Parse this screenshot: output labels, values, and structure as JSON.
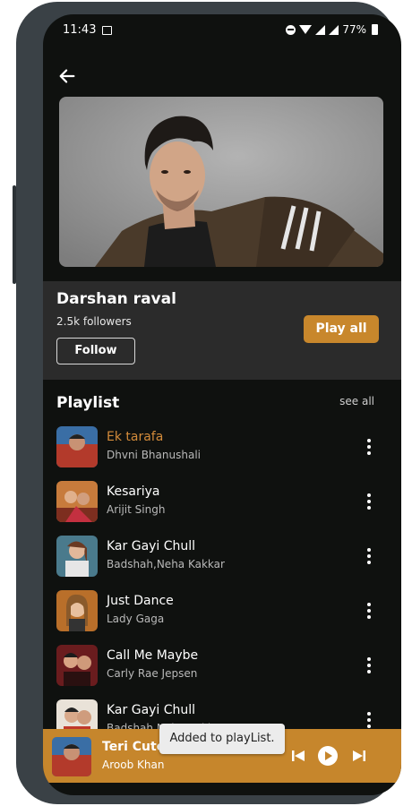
{
  "status_bar": {
    "time": "11:43",
    "battery": "77%"
  },
  "artist": {
    "name": "Darshan raval",
    "followers": "2.5k followers",
    "follow_label": "Follow",
    "play_all_label": "Play all"
  },
  "playlist": {
    "title": "Playlist",
    "see_all": "see all",
    "tracks": [
      {
        "title": "Ek tarafa",
        "artist": "Dhvni Bhanushali"
      },
      {
        "title": "Kesariya",
        "artist": "Arijit Singh"
      },
      {
        "title": "Kar Gayi Chull",
        "artist": "Badshah,Neha Kakkar"
      },
      {
        "title": "Just Dance",
        "artist": "Lady Gaga"
      },
      {
        "title": "Call Me Maybe",
        "artist": "Carly Rae Jepsen"
      },
      {
        "title": "Kar Gayi Chull",
        "artist": "Badshah,Neha Kakkar"
      }
    ]
  },
  "now_playing": {
    "title": "Teri Cute",
    "artist": "Aroob Khan"
  },
  "toast": "Added to playList.",
  "colors": {
    "accent": "#c8872c",
    "active_track": "#d38b3a",
    "background": "#0f110f",
    "card": "#2b2b2b"
  }
}
